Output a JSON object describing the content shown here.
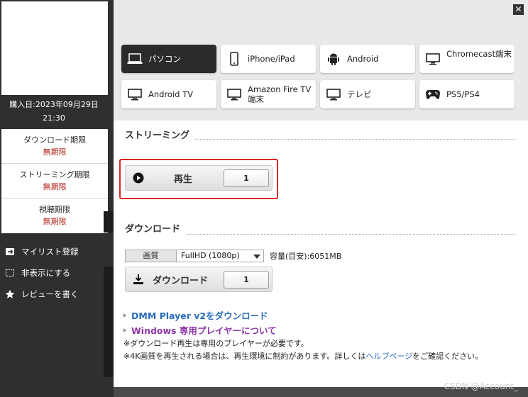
{
  "purchase": {
    "line1": "購入日:2023年09月29日",
    "line2": "21:30"
  },
  "limits": [
    {
      "label": "ダウンロード期限",
      "value": "無期限"
    },
    {
      "label": "ストリーミング期限",
      "value": "無期限"
    },
    {
      "label": "視聴期限",
      "value": "無期限"
    }
  ],
  "actions": [
    {
      "label": "マイリスト登録",
      "icon": "mylist-add-icon"
    },
    {
      "label": "非表示にする",
      "icon": "hide-icon"
    },
    {
      "label": "レビューを書く",
      "icon": "star-icon"
    }
  ],
  "devices": [
    {
      "label": "パソコン",
      "icon": "laptop-icon",
      "active": true
    },
    {
      "label": "iPhone/iPad",
      "icon": "phone-icon",
      "active": false
    },
    {
      "label": "Android",
      "icon": "android-icon",
      "active": false
    },
    {
      "label": "Chromecast端末",
      "icon": "monitor-icon",
      "active": false
    },
    {
      "label": "Android TV",
      "icon": "monitor-icon",
      "active": false
    },
    {
      "label": "Amazon Fire TV 端末",
      "icon": "monitor-icon",
      "active": false
    },
    {
      "label": "テレビ",
      "icon": "monitor-icon",
      "active": false
    },
    {
      "label": "PS5/PS4",
      "icon": "gamepad-icon",
      "active": false
    }
  ],
  "streaming": {
    "heading": "ストリーミング",
    "play_label": "再生",
    "play_count": "1"
  },
  "download": {
    "heading": "ダウンロード",
    "quality_label": "画質",
    "quality_value": "FullHD (1080p)",
    "capacity": "容量(目安):6051MB",
    "button_label": "ダウンロード",
    "button_count": "1"
  },
  "links": {
    "dmm_player": "DMM Player v2をダウンロード",
    "windows_player": "Windows 専用プレイヤーについて"
  },
  "notes": {
    "note1": "※ダウンロード再生は専用のプレイヤーが必要です。",
    "note2_pre": "※4K画質を再生される場合は、再生環境に制約があります。詳しくは",
    "note2_link": "ヘルプページ",
    "note2_post": "をご確認ください。"
  },
  "watermark": "CSDN @Account_",
  "colors": {
    "accent_red": "#e02424",
    "limit_red": "#b3261e",
    "link_blue": "#2a6dbf",
    "link_purple": "#8e35a7"
  }
}
